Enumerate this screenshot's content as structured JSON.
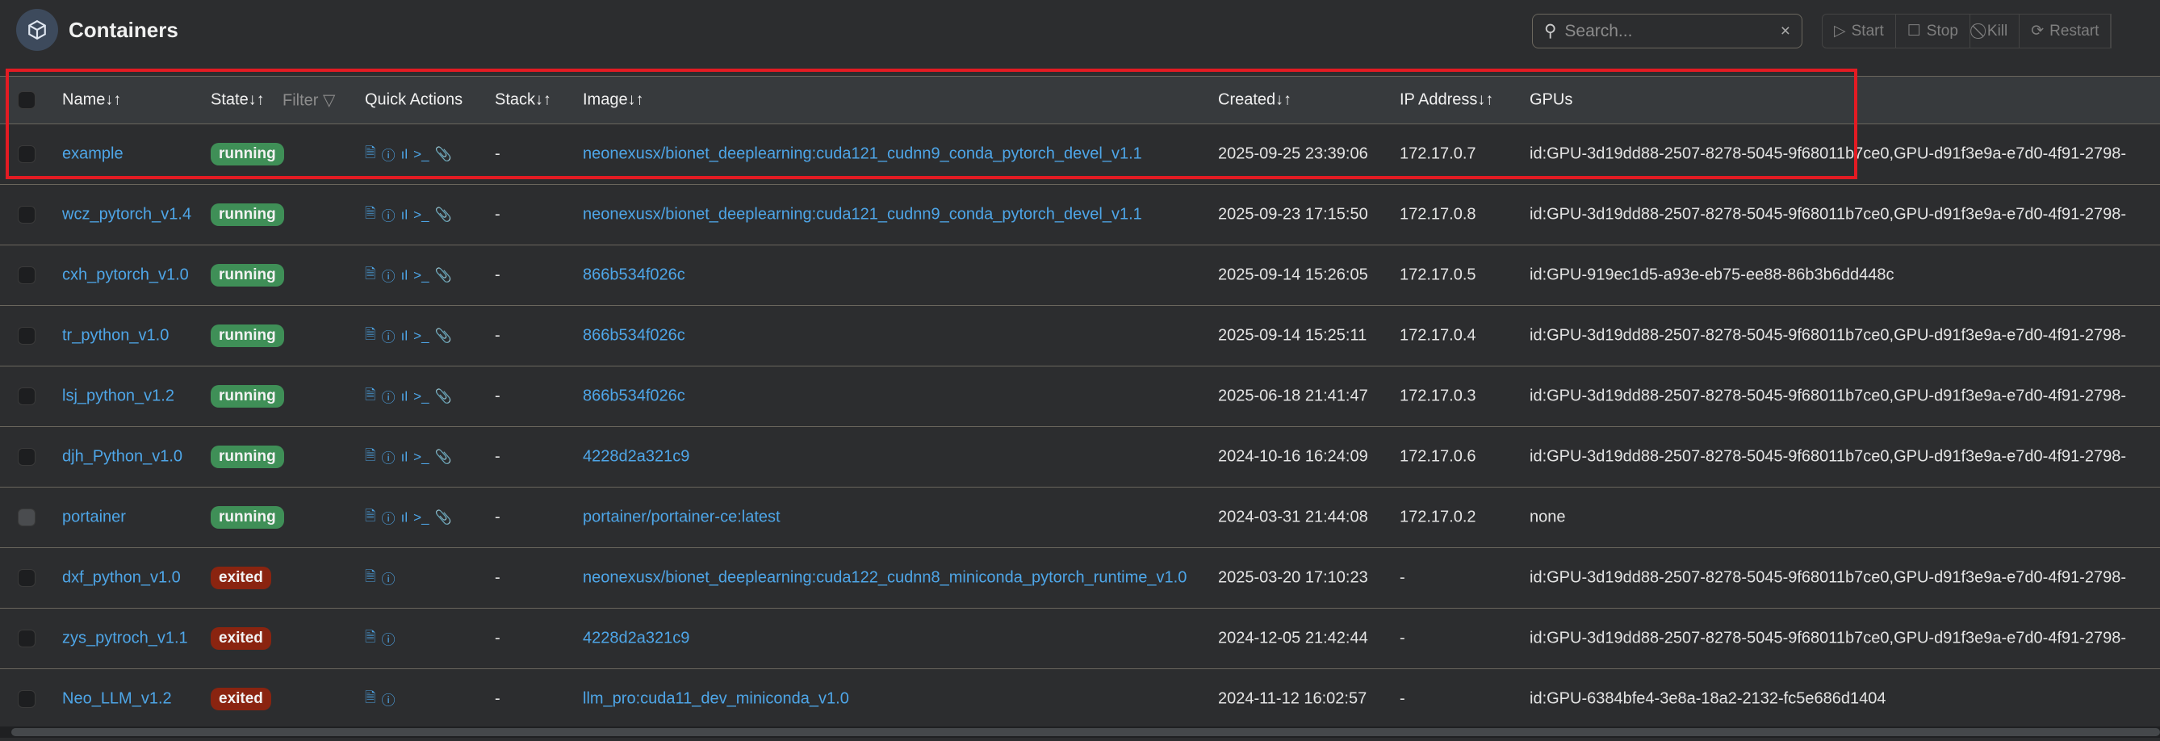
{
  "header": {
    "title": "Containers",
    "search_placeholder": "Search...",
    "clear": "×"
  },
  "toolbar": {
    "start": "Start",
    "stop": "Stop",
    "kill": "Kill",
    "restart": "Restart"
  },
  "columns": {
    "name": "Name↓↑",
    "state": "State↓↑",
    "filter": "Filter",
    "quick_actions": "Quick Actions",
    "stack": "Stack↓↑",
    "image": "Image↓↑",
    "created": "Created↓↑",
    "ip": "IP Address↓↑",
    "gpus": "GPUs"
  },
  "colors": {
    "running": "#3f8f57",
    "exited": "#8a2410",
    "link": "#4ea6e8",
    "highlight": "#e31b23"
  },
  "rows": [
    {
      "name": "example",
      "state": "running",
      "stack": "-",
      "image": "neonexusx/bionet_deeplearning:cuda121_cudnn9_conda_pytorch_devel_v1.1",
      "created": "2025-09-25 23:39:06",
      "ip": "172.17.0.7",
      "gpus": "id:GPU-3d19dd88-2507-8278-5045-9f68011b7ce0,GPU-d91f3e9a-e7d0-4f91-2798-"
    },
    {
      "name": "wcz_pytorch_v1.4",
      "state": "running",
      "stack": "-",
      "image": "neonexusx/bionet_deeplearning:cuda121_cudnn9_conda_pytorch_devel_v1.1",
      "created": "2025-09-23 17:15:50",
      "ip": "172.17.0.8",
      "gpus": "id:GPU-3d19dd88-2507-8278-5045-9f68011b7ce0,GPU-d91f3e9a-e7d0-4f91-2798-"
    },
    {
      "name": "cxh_pytorch_v1.0",
      "state": "running",
      "stack": "-",
      "image": "866b534f026c",
      "created": "2025-09-14 15:26:05",
      "ip": "172.17.0.5",
      "gpus": "id:GPU-919ec1d5-a93e-eb75-ee88-86b3b6dd448c"
    },
    {
      "name": "tr_python_v1.0",
      "state": "running",
      "stack": "-",
      "image": "866b534f026c",
      "created": "2025-09-14 15:25:11",
      "ip": "172.17.0.4",
      "gpus": "id:GPU-3d19dd88-2507-8278-5045-9f68011b7ce0,GPU-d91f3e9a-e7d0-4f91-2798-"
    },
    {
      "name": "lsj_python_v1.2",
      "state": "running",
      "stack": "-",
      "image": "866b534f026c",
      "created": "2025-06-18 21:41:47",
      "ip": "172.17.0.3",
      "gpus": "id:GPU-3d19dd88-2507-8278-5045-9f68011b7ce0,GPU-d91f3e9a-e7d0-4f91-2798-"
    },
    {
      "name": "djh_Python_v1.0",
      "state": "running",
      "stack": "-",
      "image": "4228d2a321c9",
      "created": "2024-10-16 16:24:09",
      "ip": "172.17.0.6",
      "gpus": "id:GPU-3d19dd88-2507-8278-5045-9f68011b7ce0,GPU-d91f3e9a-e7d0-4f91-2798-"
    },
    {
      "name": "portainer",
      "state": "running",
      "stack": "-",
      "image": "portainer/portainer-ce:latest",
      "created": "2024-03-31 21:44:08",
      "ip": "172.17.0.2",
      "gpus": "none",
      "disabled": true
    },
    {
      "name": "dxf_python_v1.0",
      "state": "exited",
      "stack": "-",
      "image": "neonexusx/bionet_deeplearning:cuda122_cudnn8_miniconda_pytorch_runtime_v1.0",
      "created": "2025-03-20 17:10:23",
      "ip": "-",
      "gpus": "id:GPU-3d19dd88-2507-8278-5045-9f68011b7ce0,GPU-d91f3e9a-e7d0-4f91-2798-"
    },
    {
      "name": "zys_pytroch_v1.1",
      "state": "exited",
      "stack": "-",
      "image": "4228d2a321c9",
      "created": "2024-12-05 21:42:44",
      "ip": "-",
      "gpus": "id:GPU-3d19dd88-2507-8278-5045-9f68011b7ce0,GPU-d91f3e9a-e7d0-4f91-2798-"
    },
    {
      "name": "Neo_LLM_v1.2",
      "state": "exited",
      "stack": "-",
      "image": "llm_pro:cuda11_dev_miniconda_v1.0",
      "created": "2024-11-12 16:02:57",
      "ip": "-",
      "gpus": "id:GPU-6384bfe4-3e8a-18a2-2132-fc5e686d1404"
    }
  ]
}
